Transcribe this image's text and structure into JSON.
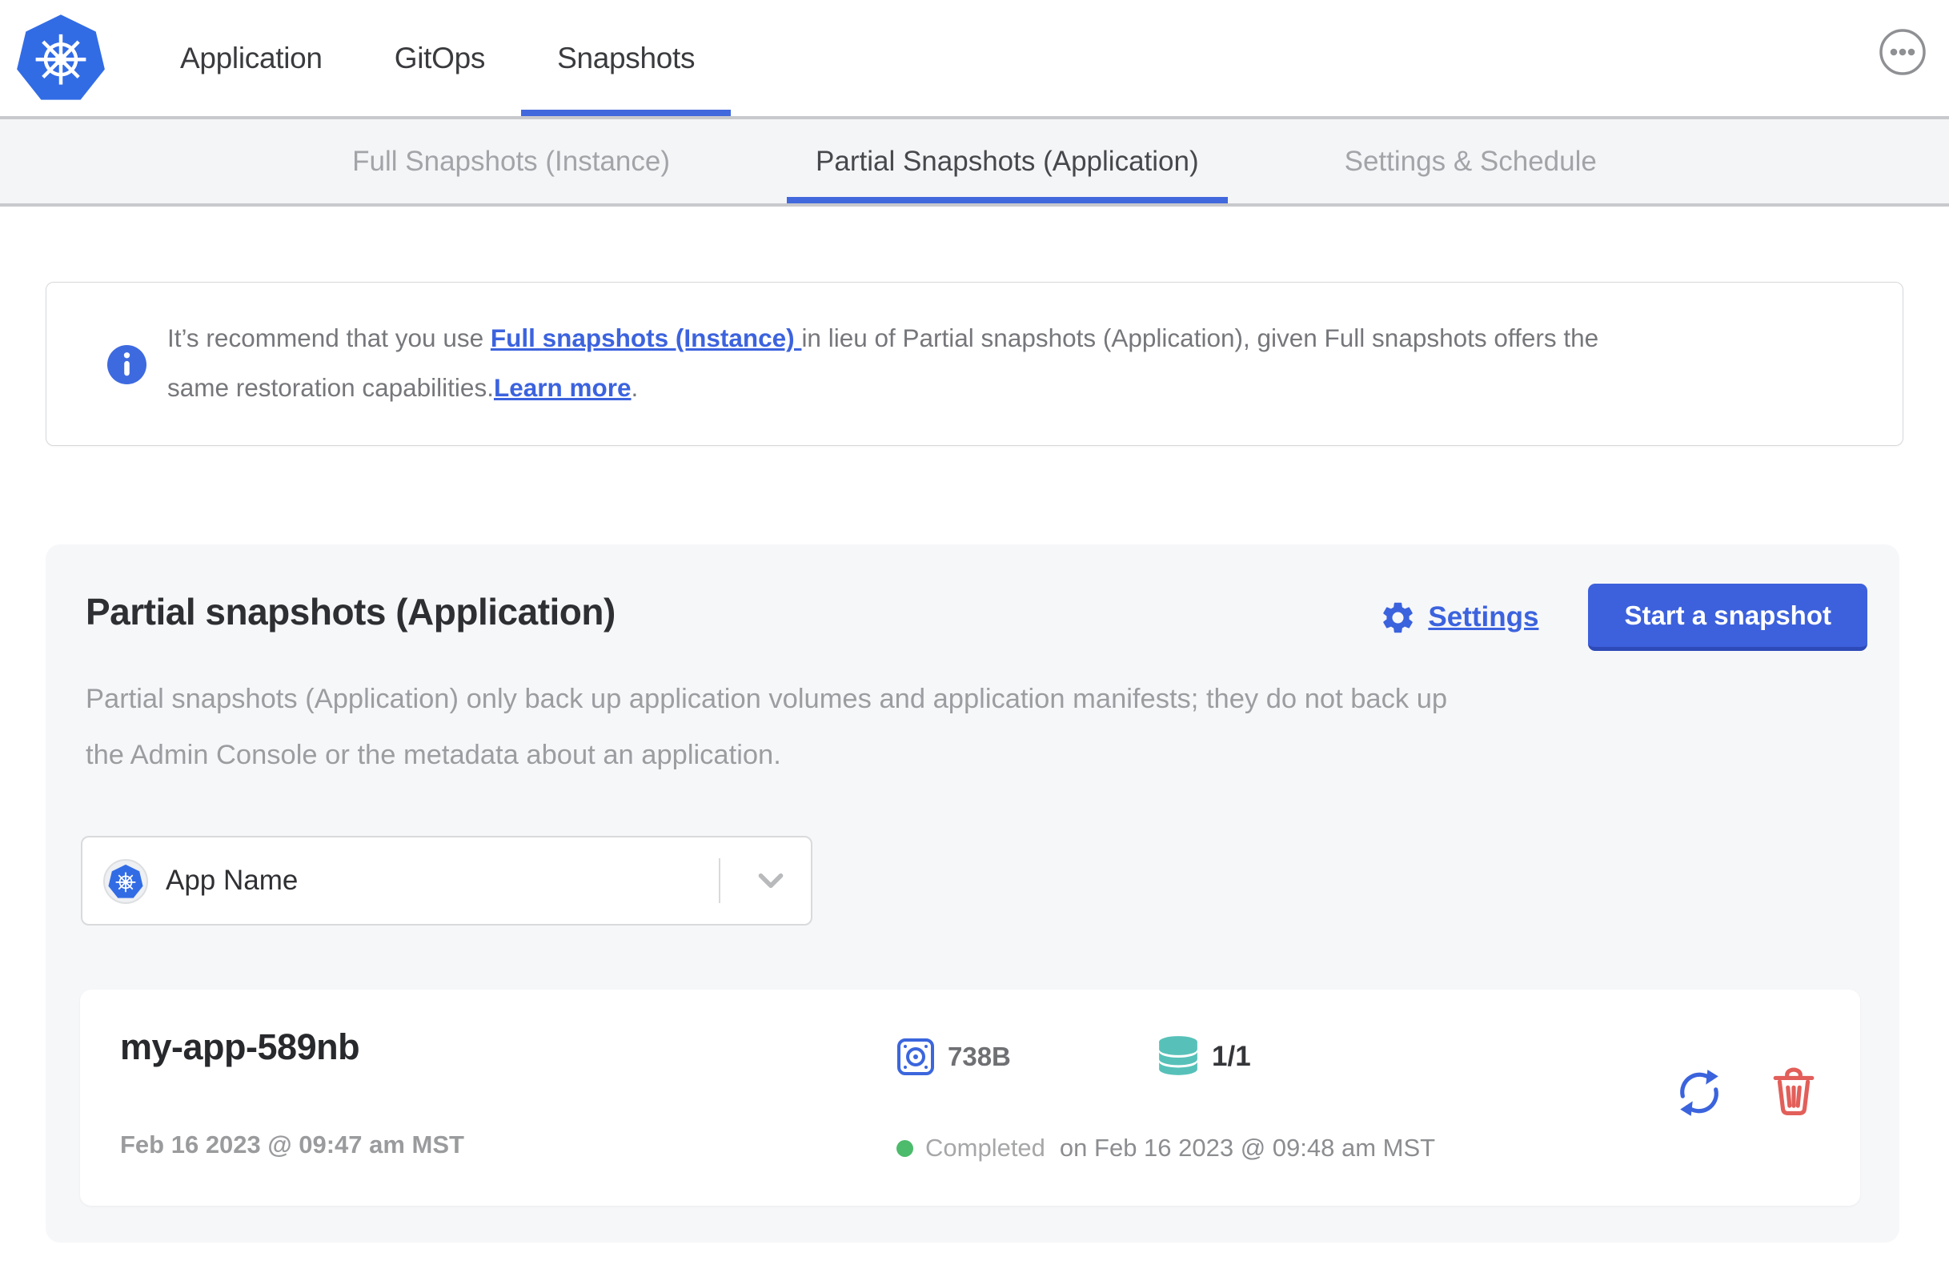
{
  "header": {
    "nav": [
      {
        "label": "Application",
        "active": false
      },
      {
        "label": "GitOps",
        "active": false
      },
      {
        "label": "Snapshots",
        "active": true
      }
    ]
  },
  "tabs": [
    {
      "label": "Full Snapshots (Instance)",
      "active": false
    },
    {
      "label": "Partial Snapshots (Application)",
      "active": true
    },
    {
      "label": "Settings & Schedule",
      "active": false
    }
  ],
  "banner": {
    "text_before_link": "It’s recommend that you use ",
    "link_full_snapshots": "Full snapshots (Instance) ",
    "text_after_link": "in lieu of Partial snapshots (Application), given Full snapshots offers the",
    "line2_text": "same restoration capabilities.",
    "link_learn_more": "Learn more",
    "period": "."
  },
  "panel": {
    "title": "Partial snapshots (Application)",
    "settings_label": "Settings",
    "start_button": "Start a snapshot",
    "description_line1": "Partial snapshots (Application) only back up application volumes and application manifests; they do not back up",
    "description_line2": "the Admin Console or the metadata about an application.",
    "app_selector_value": "App Name"
  },
  "snapshot": {
    "name": "my-app-589nb",
    "started": "Feb 16 2023 @ 09:47 am MST",
    "size": "738B",
    "volumes": "1/1",
    "status": "Completed",
    "finished": "on Feb 16 2023 @ 09:48 am MST"
  },
  "icons": [
    "kubernetes-logo-icon",
    "more-menu-icon",
    "info-icon",
    "gear-icon",
    "chevron-down-icon",
    "disk-icon",
    "database-icon",
    "status-dot",
    "restore-icon",
    "trash-icon"
  ],
  "colors": {
    "accent_blue": "#3d61dc",
    "link_blue": "#3c63de",
    "underline_blue": "#4268dd",
    "kubernetes_blue": "#326ce5",
    "teal": "#57c1b9",
    "green": "#4cbb6c",
    "red": "#e25f5a",
    "tabbar_bg": "#f4f5f7",
    "panel_bg": "#f6f7f9"
  }
}
